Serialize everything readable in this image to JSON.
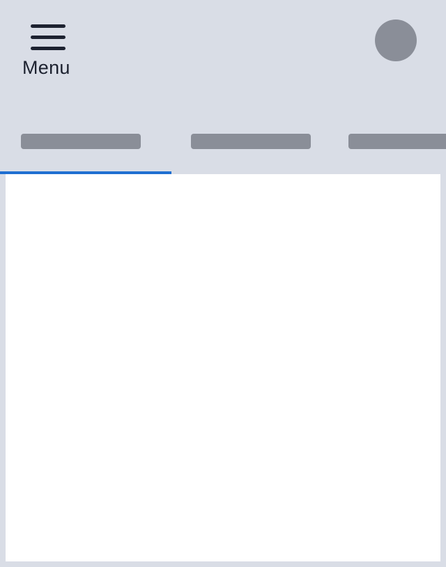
{
  "header": {
    "menu_label": "Menu",
    "menu_icon": "hamburger-icon",
    "avatar_icon": "user-avatar"
  },
  "tabs": [
    {
      "id": "tab-1",
      "selected": true
    },
    {
      "id": "tab-2",
      "selected": false
    },
    {
      "id": "tab-3",
      "selected": false
    }
  ],
  "colors": {
    "background": "#d9dde6",
    "text": "#1d2230",
    "placeholder": "#8a8e98",
    "accent": "#1f6fd1",
    "panel": "#ffffff"
  }
}
